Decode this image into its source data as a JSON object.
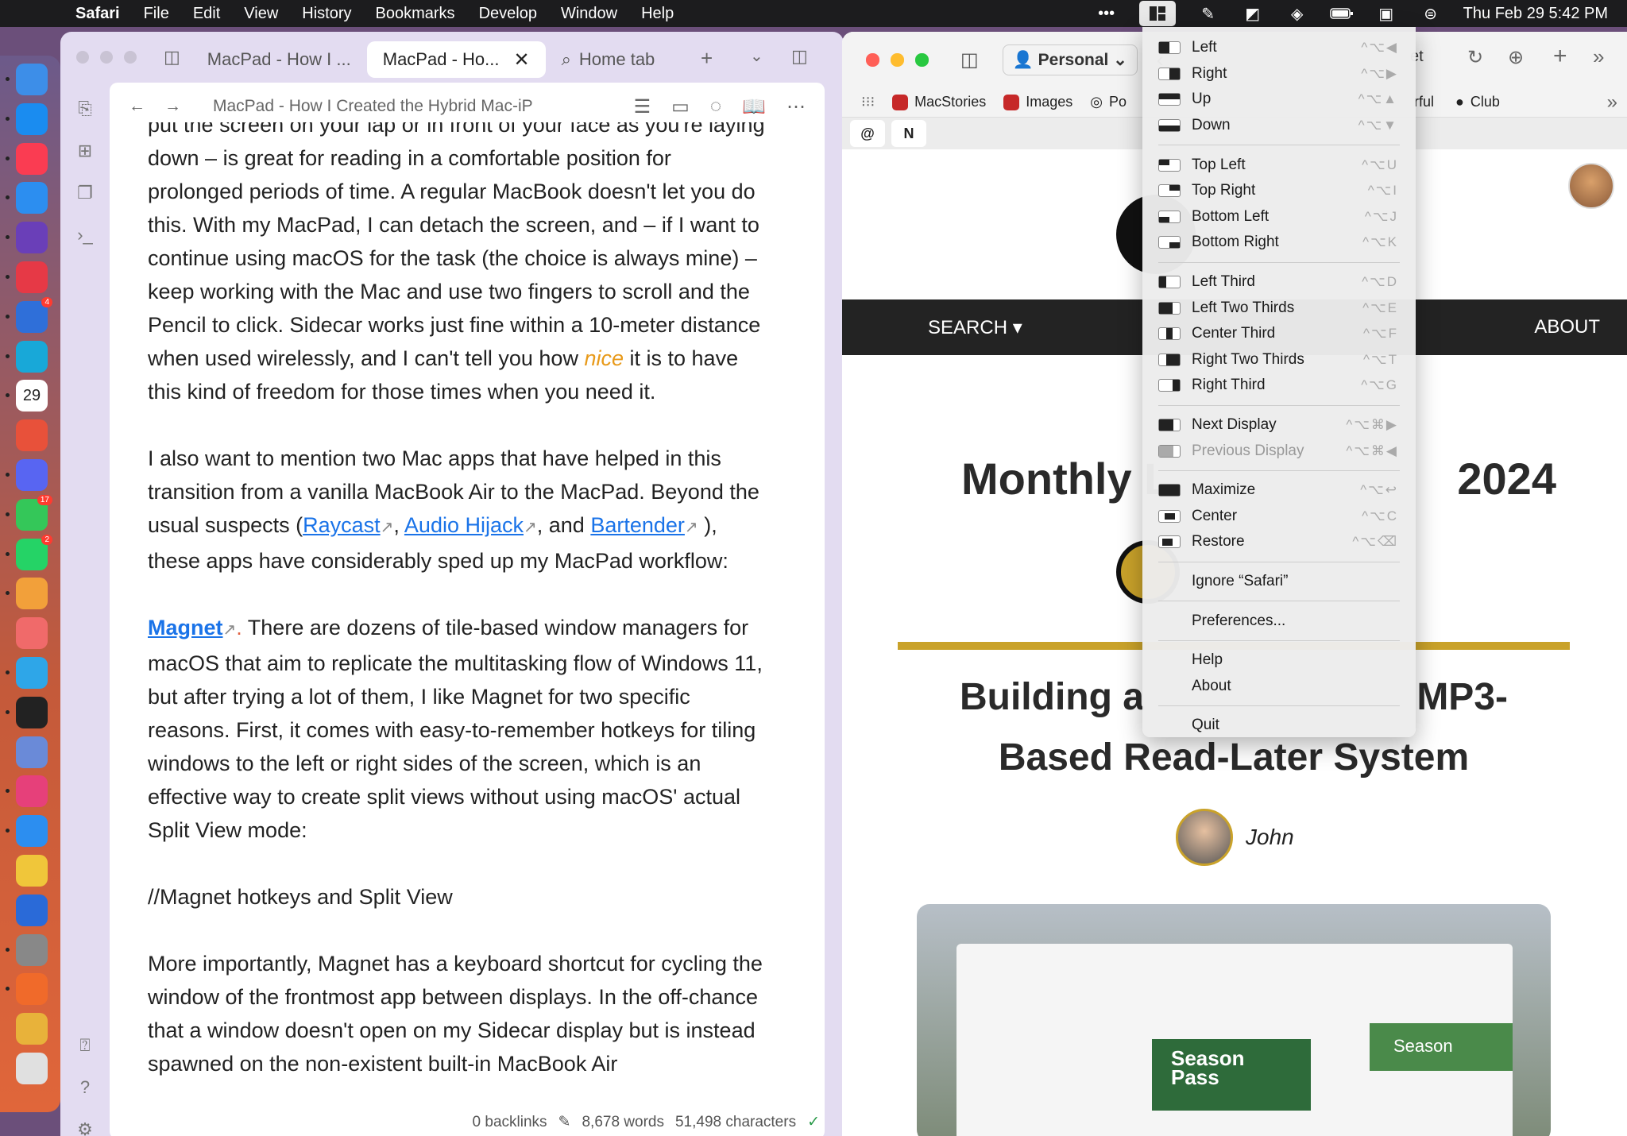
{
  "menubar": {
    "app": "Safari",
    "items": [
      "File",
      "Edit",
      "View",
      "History",
      "Bookmarks",
      "Develop",
      "Window",
      "Help"
    ],
    "clock": "Thu Feb 29  5:42 PM"
  },
  "dock": {
    "icons": [
      {
        "name": "finder",
        "color": "#3d8ee8"
      },
      {
        "name": "app-store",
        "color": "#1a8cf0"
      },
      {
        "name": "music",
        "color": "#fa3c52"
      },
      {
        "name": "safari",
        "color": "#2c8ef0"
      },
      {
        "name": "obsidian",
        "color": "#6a3fb8"
      },
      {
        "name": "goodlinks",
        "color": "#e63946"
      },
      {
        "name": "things",
        "color": "#2f6fd9",
        "badge": "4"
      },
      {
        "name": "tot",
        "color": "#18a8d8"
      },
      {
        "name": "calendar",
        "color": "#ffffff",
        "label": "29"
      },
      {
        "name": "shortcuts",
        "color": "#e8513a"
      },
      {
        "name": "discord",
        "color": "#5865f2"
      },
      {
        "name": "messages",
        "color": "#34c759",
        "badge": "17"
      },
      {
        "name": "whatsapp",
        "color": "#25d366",
        "badge": "2"
      },
      {
        "name": "photos",
        "color": "#f2a03a"
      },
      {
        "name": "preview",
        "color": "#f06a6a"
      },
      {
        "name": "downloader",
        "color": "#2ea6e8"
      },
      {
        "name": "audio-hijack",
        "color": "#222222"
      },
      {
        "name": "tableplus",
        "color": "#6a8ad8"
      },
      {
        "name": "threads",
        "color": "#e6407a"
      },
      {
        "name": "spark",
        "color": "#2c8ef0"
      },
      {
        "name": "archive",
        "color": "#f0c63a"
      },
      {
        "name": "paragraph",
        "color": "#2a6ad8"
      },
      {
        "name": "system-settings",
        "color": "#888888"
      },
      {
        "name": "firefox-orb",
        "color": "#f06a2a"
      },
      {
        "name": "fruit",
        "color": "#e8b23a"
      },
      {
        "name": "trash",
        "color": "#e0e0e0"
      }
    ]
  },
  "obsidian": {
    "tabs": [
      {
        "label": "MacPad - How I ..."
      },
      {
        "label": "MacPad - Ho..."
      },
      {
        "label": "Home tab"
      }
    ],
    "note_title": "MacPad - How I Created the Hybrid Mac-iP",
    "paragraphs": {
      "p1": "put the screen on your lap or in front of your face as you're laying down – is great for reading in a comfortable position for prolonged periods of time. A regular MacBook doesn't let you do this. With my MacPad, I can detach the screen, and – if I want to continue using macOS for the task (the choice is always mine) – keep working with the Mac and use two fingers to scroll and the Pencil to click. Sidecar works just fine within a 10-meter distance when used wirelessly, and I can't tell you how",
      "p1_em": "nice",
      "p1_end": "it is to have this kind of freedom for those times when you need it.",
      "p2_start": "I also want to mention two Mac apps that have helped in this transition from a vanilla MacBook Air to the MacPad. Beyond the usual suspects (",
      "link_raycast": "Raycast",
      "link_audio": "Audio Hijack",
      "and": ", and",
      "link_bartender": "Bartender",
      "p2_end": "), these apps have considerably sped up my MacPad workflow:",
      "magnet": "Magnet",
      "p3": "There are dozens of tile-based window managers for macOS that aim to replicate the multitasking flow of Windows 11, but after trying a lot of them, I like Magnet for two specific reasons. First, it comes with easy-to-remember hotkeys for tiling windows to the left or right sides of the screen, which is an effective way to create split views without using macOS' actual Split View mode:",
      "p4": "//Magnet hotkeys and Split View",
      "p5": "More importantly, Magnet has a keyboard shortcut for cycling the window of the frontmost app between displays. In the off-chance that a window doesn't open on my Sidecar display but is instead spawned on the non-existent built-in MacBook Air"
    },
    "status": {
      "backlinks": "0 backlinks",
      "words": "8,678 words",
      "chars": "51,498 characters"
    }
  },
  "safari": {
    "profile": "Personal",
    "url_fragment": "et",
    "favorites": [
      "MacStories",
      "Images",
      "Po",
      "rful",
      "Club"
    ],
    "nav": {
      "search": "SEARCH",
      "about": "ABOUT"
    },
    "headline1_start": "Monthly L",
    "headline1_end": "2024",
    "headline2_start": "Building a ",
    "headline2_end": "MP3-",
    "headline2_line2": "Based Read-Later System",
    "author": "John",
    "hero": {
      "mls": "Season Pass",
      "mls2": "Season"
    }
  },
  "magnet_menu": {
    "groups": [
      [
        {
          "label": "Left",
          "shortcut": "^⌥◀",
          "fill": "left"
        },
        {
          "label": "Right",
          "shortcut": "^⌥▶",
          "fill": "right"
        },
        {
          "label": "Up",
          "shortcut": "^⌥▲",
          "fill": "up"
        },
        {
          "label": "Down",
          "shortcut": "^⌥▼",
          "fill": "down"
        }
      ],
      [
        {
          "label": "Top Left",
          "shortcut": "^⌥U",
          "fill": "tl"
        },
        {
          "label": "Top Right",
          "shortcut": "^⌥I",
          "fill": "tr"
        },
        {
          "label": "Bottom Left",
          "shortcut": "^⌥J",
          "fill": "bl"
        },
        {
          "label": "Bottom Right",
          "shortcut": "^⌥K",
          "fill": "br"
        }
      ],
      [
        {
          "label": "Left Third",
          "shortcut": "^⌥D",
          "fill": "l3"
        },
        {
          "label": "Left Two Thirds",
          "shortcut": "^⌥E",
          "fill": "l23"
        },
        {
          "label": "Center Third",
          "shortcut": "^⌥F",
          "fill": "c3"
        },
        {
          "label": "Right Two Thirds",
          "shortcut": "^⌥T",
          "fill": "r23"
        },
        {
          "label": "Right Third",
          "shortcut": "^⌥G",
          "fill": "r3"
        }
      ],
      [
        {
          "label": "Next Display",
          "shortcut": "^⌥⌘▶",
          "fill": "next"
        },
        {
          "label": "Previous Display",
          "shortcut": "^⌥⌘◀",
          "fill": "prev",
          "disabled": true
        }
      ],
      [
        {
          "label": "Maximize",
          "shortcut": "^⌥↩",
          "fill": "max"
        },
        {
          "label": "Center",
          "shortcut": "^⌥C",
          "fill": "center"
        },
        {
          "label": "Restore",
          "shortcut": "^⌥⌫",
          "fill": "restore"
        }
      ],
      [
        {
          "label": "Ignore “Safari”"
        }
      ],
      [
        {
          "label": "Preferences..."
        }
      ],
      [
        {
          "label": "Help"
        },
        {
          "label": "About"
        }
      ],
      [
        {
          "label": "Quit"
        }
      ]
    ]
  }
}
